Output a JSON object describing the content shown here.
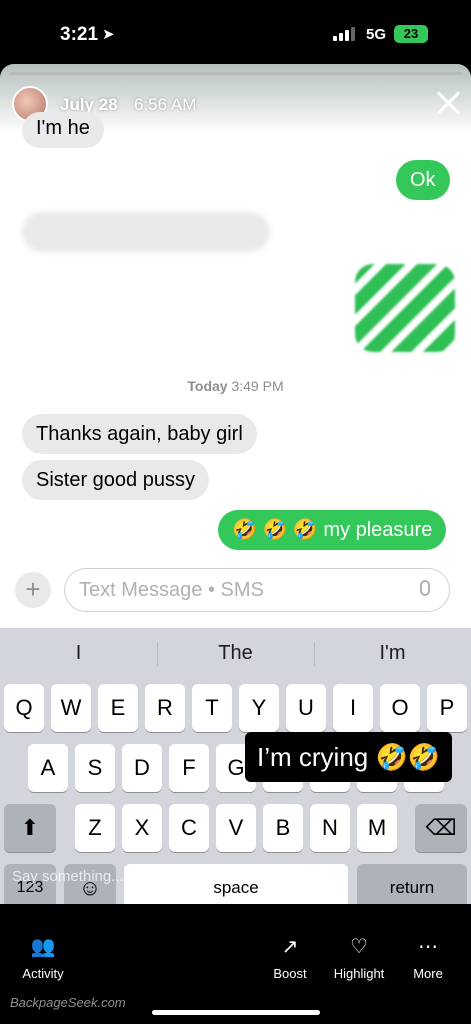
{
  "status_bar": {
    "time": "3:21",
    "network": "5G",
    "battery": "23"
  },
  "story_header": {
    "date": "July 28",
    "time": "6:56 AM"
  },
  "messages": {
    "top_partial": "I'm he",
    "ok": "Ok",
    "timestamp_day": "Today",
    "timestamp_time": "3:49 PM",
    "recv_1": "Thanks again, baby girl",
    "recv_2": "Sister good pussy",
    "sent_1": "🤣 🤣 🤣 my pleasure"
  },
  "composer": {
    "placeholder": "Text Message • SMS"
  },
  "keyboard": {
    "suggestions": [
      "I",
      "The",
      "I'm"
    ],
    "row1": [
      "Q",
      "W",
      "E",
      "R",
      "T",
      "Y",
      "U",
      "I",
      "O",
      "P"
    ],
    "row2": [
      "A",
      "S",
      "D",
      "F",
      "G"
    ],
    "row3": [
      "Z",
      "X",
      "C",
      "V",
      "B",
      "N",
      "M"
    ],
    "numbers_key": "123",
    "space_key": "space",
    "return_key": "return"
  },
  "caption": "I’m crying 🤣🤣",
  "reply_placeholder": "Say something...",
  "bottom_bar": {
    "activity": "Activity",
    "boost": "Boost",
    "highlight": "Highlight",
    "more": "More"
  },
  "watermark": "BackpageSeek.com",
  "colors": {
    "imessage_green": "#34c759",
    "received_gray": "#e9e9eb",
    "keyboard_bg": "#d2d5db"
  }
}
